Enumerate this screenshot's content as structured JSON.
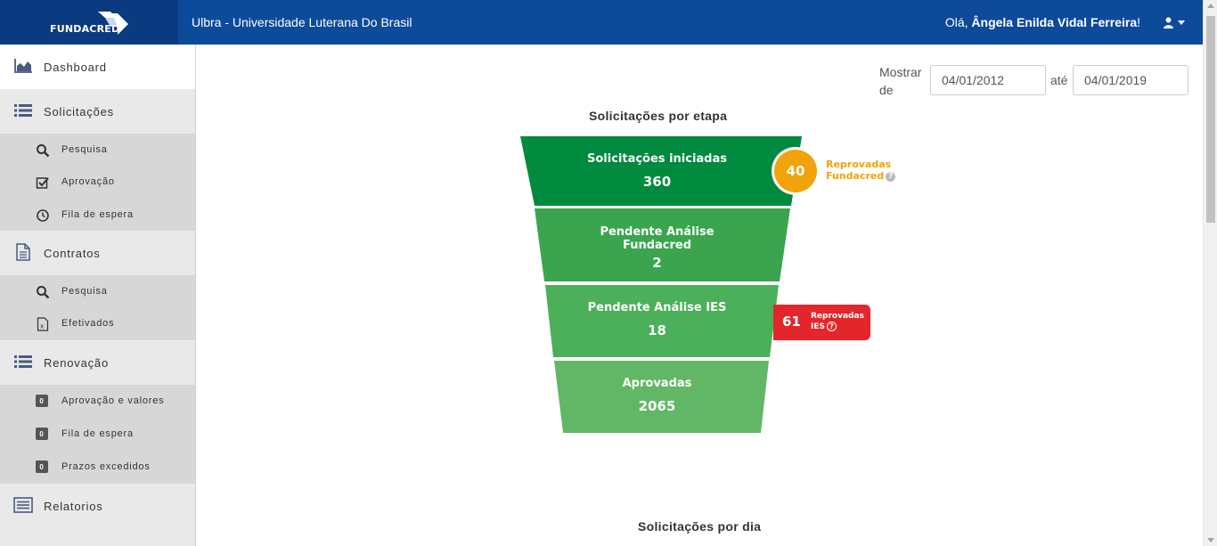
{
  "header": {
    "logo_text": "FUNDACRED",
    "institution": "Ulbra - Universidade Luterana Do Brasil",
    "greeting_prefix": "Olá, ",
    "user_name": "Ângela Enilda Vidal Ferreira",
    "greeting_suffix": "!"
  },
  "sidebar": {
    "dashboard": "Dashboard",
    "solicitacoes": "Solicitações",
    "solicitacoes_items": [
      "Pesquisa",
      "Aprovação",
      "Fila de espera"
    ],
    "contratos": "Contratos",
    "contratos_items": [
      "Pesquisa",
      "Efetivados"
    ],
    "renovacao": "Renovação",
    "renovacao_items": [
      {
        "badge": "0",
        "label": "Aprovação e valores"
      },
      {
        "badge": "0",
        "label": "Fila de espera"
      },
      {
        "badge": "0",
        "label": "Prazos excedidos"
      }
    ],
    "relatorios": "Relatorios"
  },
  "filters": {
    "show_label": "Mostrar de",
    "date_from": "04/01/2012",
    "until_label": "até",
    "date_to": "04/01/2019"
  },
  "funnel": {
    "title": "Solicitações por etapa",
    "stages": [
      {
        "label": "Solicitações iniciadas",
        "value": "360",
        "color": "#008a3e"
      },
      {
        "label": "Pendente Análise Fundacred",
        "value": "2",
        "color": "#3aa54e"
      },
      {
        "label": "Pendente Análise IES",
        "value": "18",
        "color": "#4caf5a"
      },
      {
        "label": "Aprovadas",
        "value": "2065",
        "color": "#62b766"
      }
    ],
    "rejected_fundacred": {
      "value": "40",
      "label_line1": "Reprovadas",
      "label_line2": "Fundacred",
      "color": "#f0a30a"
    },
    "rejected_ies": {
      "value": "61",
      "label_line1": "Reprovadas",
      "label_line2": "IES",
      "color": "#e3262c"
    }
  },
  "daily_chart": {
    "title": "Solicitações por dia"
  }
}
